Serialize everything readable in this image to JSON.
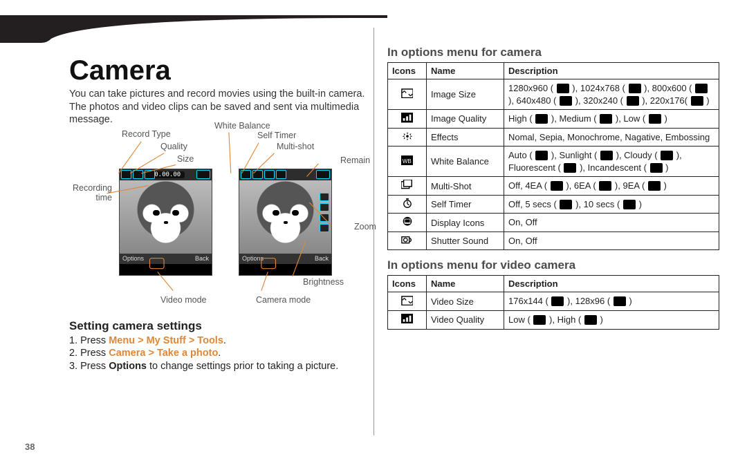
{
  "page_number": "38",
  "left": {
    "title": "Camera",
    "intro": "You can take pictures and record movies using the built-in camera. The photos and video clips can be saved and sent via multimedia message.",
    "diagram": {
      "labels": {
        "record_type": "Record Type",
        "quality": "Quality",
        "size": "Size",
        "white_balance": "White Balance",
        "self_timer": "Self Timer",
        "multi_shot": "Multi-shot",
        "remain": "Remain",
        "recording_time": "Recording\ntime",
        "zoom": "Zoom",
        "brightness": "Brightness",
        "video_mode": "Video mode",
        "camera_mode": "Camera mode"
      },
      "counter": "00.00.00",
      "softkeys": {
        "left": "Options",
        "right": "Back"
      }
    },
    "sub_heading": "Setting camera settings",
    "steps": [
      {
        "prefix": "1. Press ",
        "strong": "Menu > My Stuff > Tools",
        "suffix": "."
      },
      {
        "prefix": "2. Press ",
        "strong": "Camera > Take a photo",
        "suffix": "."
      },
      {
        "prefix": "3. Press ",
        "strong_black": "Options",
        "suffix": " to change settings prior to taking a picture."
      }
    ]
  },
  "right": {
    "heading_camera": "In options menu for camera",
    "heading_video": "In options menu for video camera",
    "headers": {
      "icons": "Icons",
      "name": "Name",
      "desc": "Description"
    },
    "camera_rows": [
      {
        "icon": "image-size-icon",
        "name": "Image Size",
        "desc": "1280x960 ( ▮ ), 1024x768 ( ▮ ), 800x600 ( ▮ ), 640x480 ( ▮ ), 320x240 ( ▮ ), 220x176( ▮ )"
      },
      {
        "icon": "image-quality-icon",
        "name": "Image Quality",
        "desc": "High ( ▮ ), Medium ( ▮ ), Low ( ▮ )"
      },
      {
        "icon": "effects-icon",
        "name": "Effects",
        "desc": "Nomal, Sepia, Monochrome, Nagative, Embossing"
      },
      {
        "icon": "white-balance-icon",
        "name": "White Balance",
        "desc": "Auto ( ▮ ), Sunlight ( ▮ ), Cloudy ( ▮ ), Fluorescent ( ▮ ), Incandescent ( ▮ )"
      },
      {
        "icon": "multi-shot-icon",
        "name": "Multi-Shot",
        "desc": "Off, 4EA ( ▮ ), 6EA ( ▮ ), 9EA ( ▮ )"
      },
      {
        "icon": "self-timer-icon",
        "name": "Self Timer",
        "desc": "Off, 5 secs ( ▮ ), 10 secs ( ▮ )"
      },
      {
        "icon": "display-icons-icon",
        "name": "Display Icons",
        "desc": "On, Off"
      },
      {
        "icon": "shutter-sound-icon",
        "name": "Shutter Sound",
        "desc": "On, Off"
      }
    ],
    "video_rows": [
      {
        "icon": "video-size-icon",
        "name": "Video Size",
        "desc": "176x144 ( ▮ ), 128x96 ( ▮ )"
      },
      {
        "icon": "video-quality-icon",
        "name": "Video Quality",
        "desc": "Low ( ▮ ), High ( ▮ )"
      }
    ]
  }
}
